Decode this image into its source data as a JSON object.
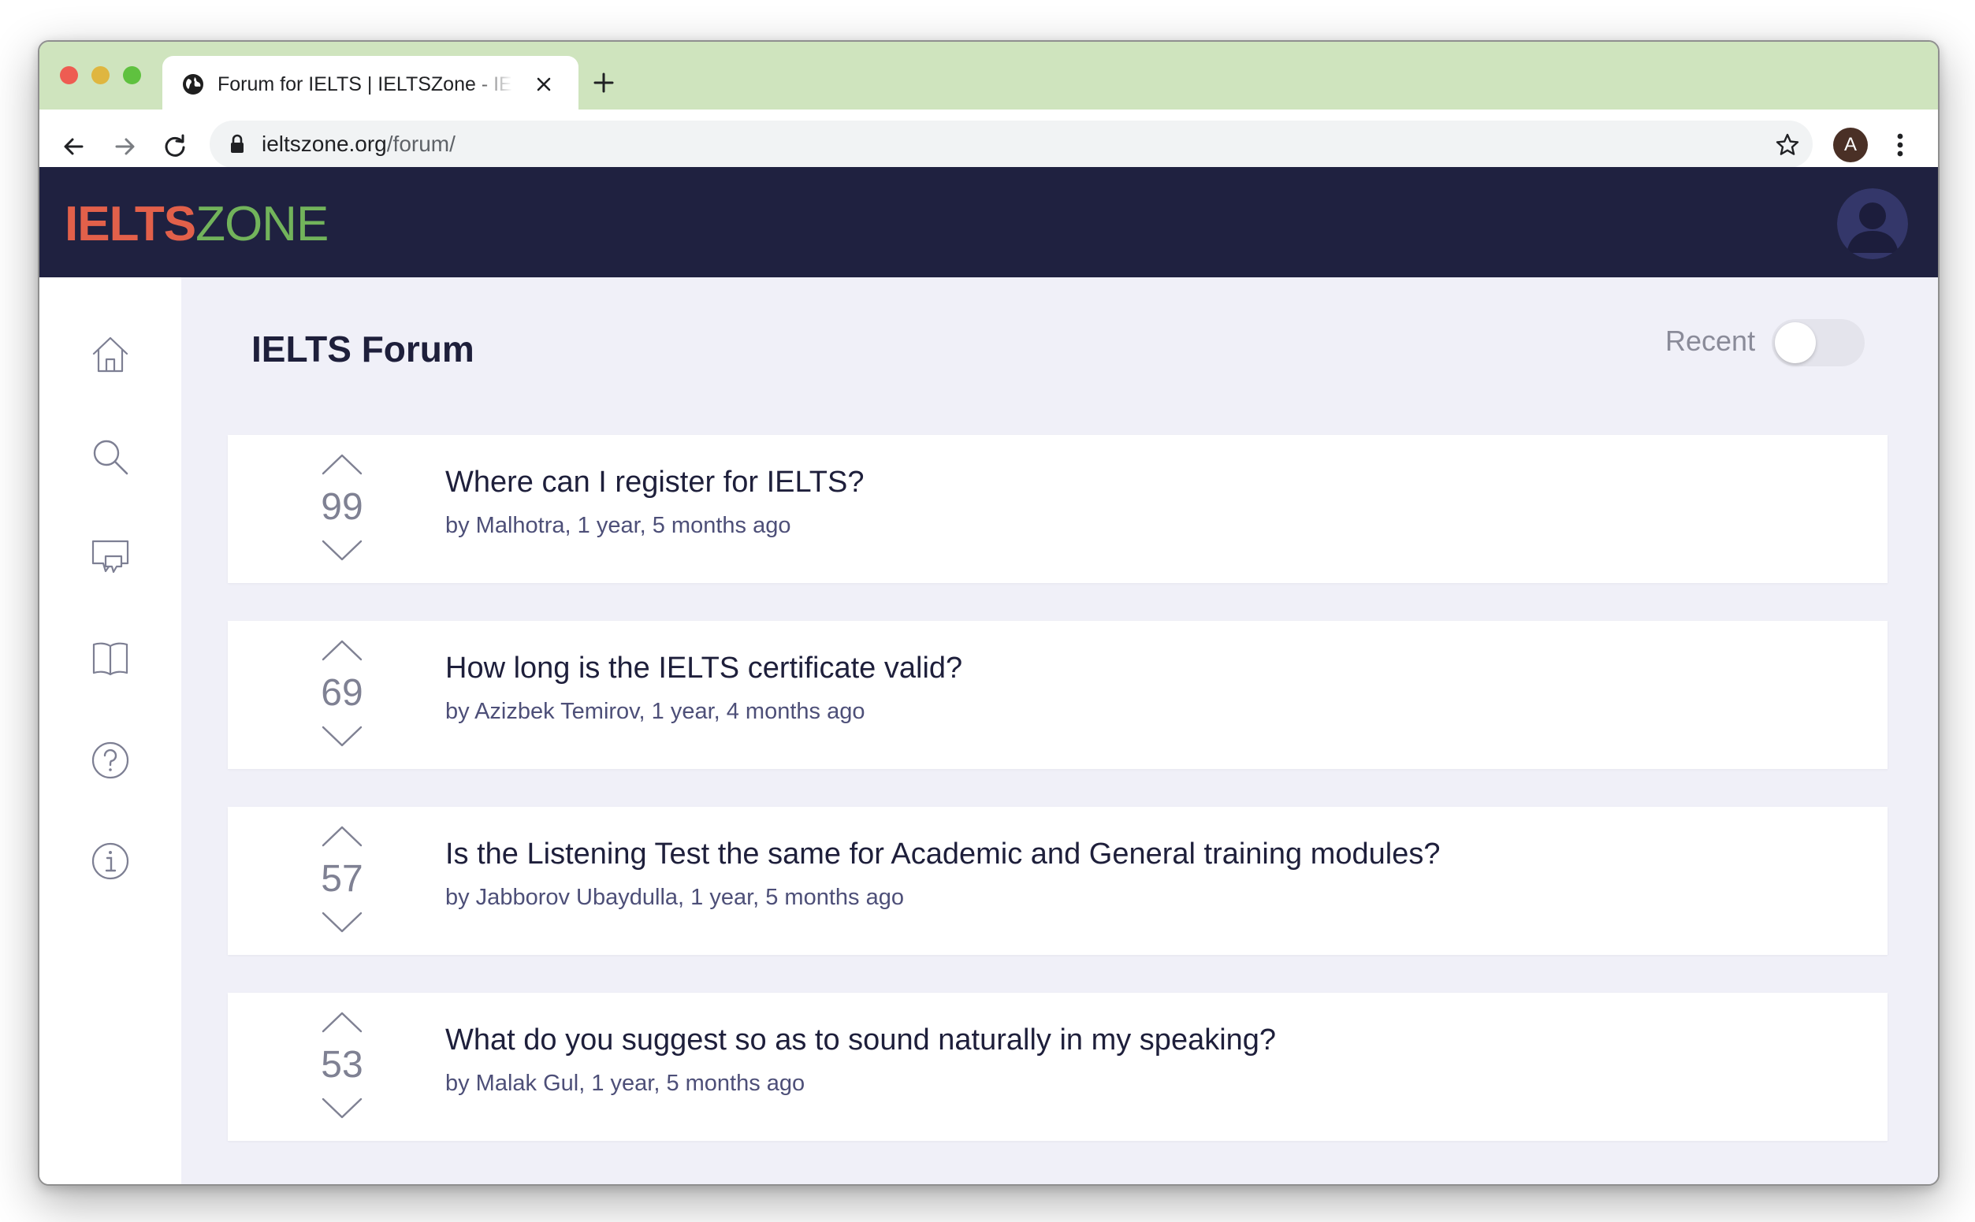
{
  "browser": {
    "tab_title": "Forum for IELTS | IELTSZone - IELTS Preparation",
    "url_domain": "ieltszone.org",
    "url_path": "/forum/",
    "profile_initial": "A",
    "tab_bar_color": "#cfe4be"
  },
  "site": {
    "logo_part1": "IELTS",
    "logo_part2": "ZONE",
    "header_color": "#1f2140",
    "logo_colors": [
      "#e2604a",
      "#72b35b"
    ]
  },
  "sidebar": {
    "icons": [
      "home-icon",
      "search-icon",
      "chat-icon",
      "book-icon",
      "help-icon",
      "info-icon"
    ]
  },
  "main": {
    "title": "IELTS Forum",
    "recent_label": "Recent",
    "recent_toggle_on": false
  },
  "posts": [
    {
      "votes": "99",
      "title": "Where can I register for IELTS?",
      "meta": "by Malhotra, 1 year, 5 months ago"
    },
    {
      "votes": "69",
      "title": "How long is the IELTS certificate valid?",
      "meta": "by Azizbek Temirov, 1 year, 4 months ago"
    },
    {
      "votes": "57",
      "title": "Is the Listening Test the same for Academic and General training modules?",
      "meta": "by Jabborov Ubaydulla, 1 year, 5 months ago"
    },
    {
      "votes": "53",
      "title": "What do you suggest so as to sound naturally in my speaking?",
      "meta": "by Malak Gul, 1 year, 5 months ago"
    }
  ]
}
